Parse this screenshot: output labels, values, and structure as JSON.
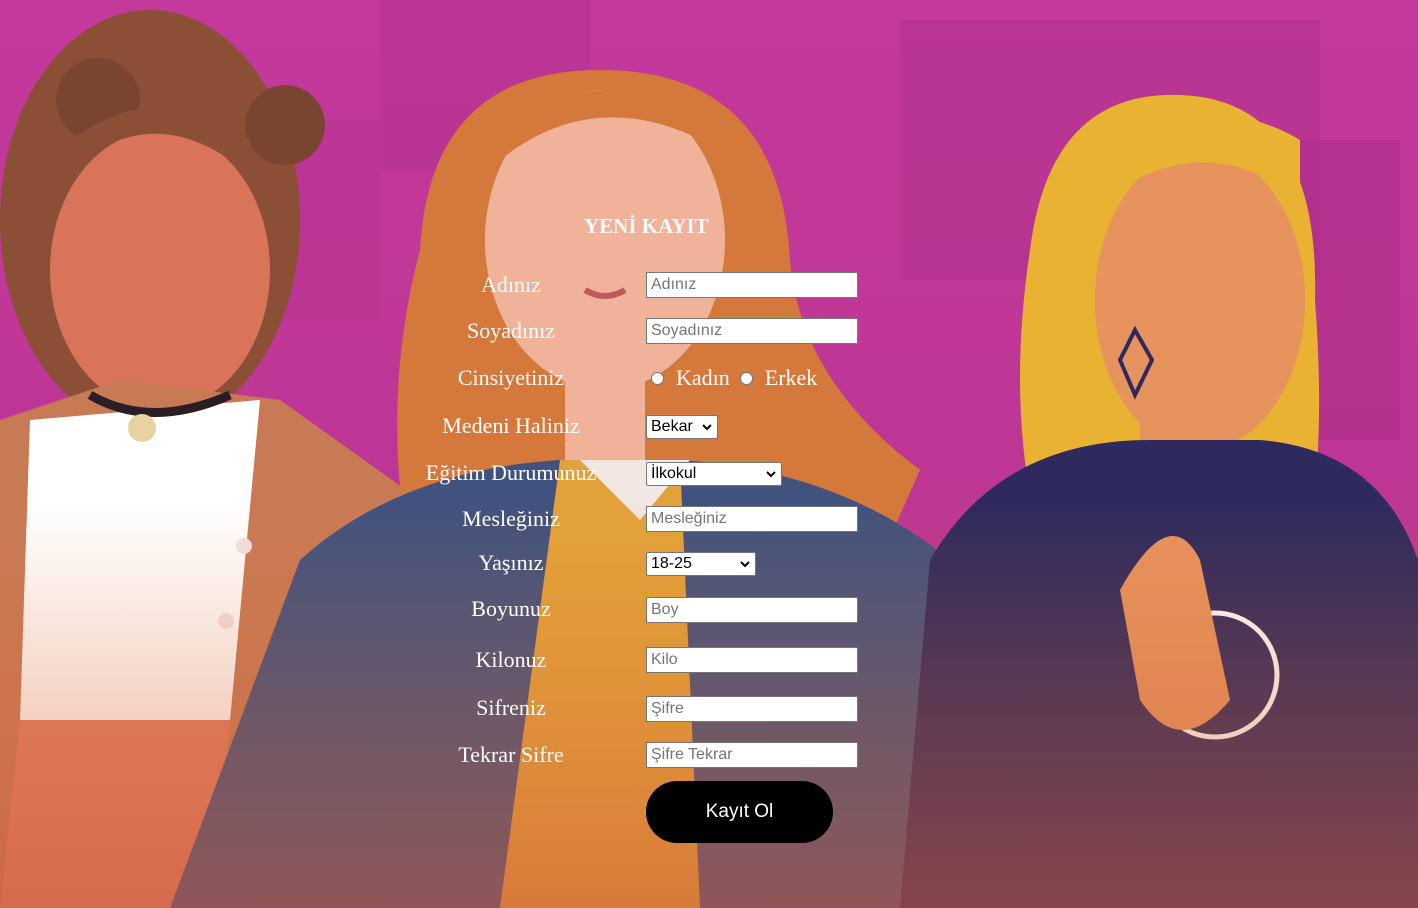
{
  "form": {
    "title": "YENİ KAYIT",
    "fields": {
      "adiniz": {
        "label": "Adınız",
        "placeholder": "Adınız"
      },
      "soyadiniz": {
        "label": "Soyadınız",
        "placeholder": "Soyadınız"
      },
      "cinsiyet": {
        "label": "Cinsiyetiniz",
        "options": [
          "Kadın",
          "Erkek"
        ]
      },
      "medeni": {
        "label": "Medeni Haliniz",
        "selected": "Bekar"
      },
      "egitim": {
        "label": "Eğitim Durumunuz",
        "selected": "İlkokul"
      },
      "meslek": {
        "label": "Mesleğiniz",
        "placeholder": "Mesleğiniz"
      },
      "yas": {
        "label": "Yaşınız",
        "selected": "18-25"
      },
      "boy": {
        "label": "Boyunuz",
        "placeholder": "Boy"
      },
      "kilo": {
        "label": "Kilonuz",
        "placeholder": "Kilo"
      },
      "sifre": {
        "label": "Sifreniz",
        "placeholder": "Şifre"
      },
      "sifre_tekrar": {
        "label": "Tekrar Sifre",
        "placeholder": "Şifre Tekrar"
      }
    },
    "submit_label": "Kayıt Ol"
  },
  "colors": {
    "background": "#c23a98",
    "text": "#ffffff",
    "button": "#000000"
  }
}
